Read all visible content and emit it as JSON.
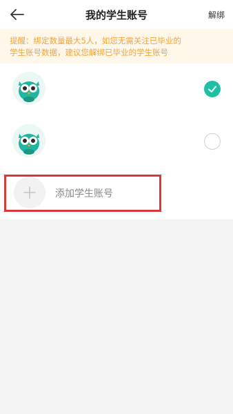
{
  "header": {
    "back_icon": "arrow-left-icon",
    "title": "我的学生账号",
    "action_label": "解绑"
  },
  "notice": {
    "text": "提醒：绑定数量最大5人，如您无需关注已毕业的\n学生账号数据，建议您解绑已毕业的学生账号"
  },
  "accounts": [
    {
      "avatar_icon": "owl-avatar-icon",
      "name": "",
      "selected": true
    },
    {
      "avatar_icon": "owl-avatar-icon",
      "name": "",
      "selected": false
    }
  ],
  "add_account": {
    "icon": "plus-icon",
    "label": "添加学生账号"
  },
  "colors": {
    "accent": "#1fbfa6",
    "notice_text": "#f2a43a",
    "notice_bg": "#fff7ea",
    "highlight_border": "#d9363e"
  }
}
